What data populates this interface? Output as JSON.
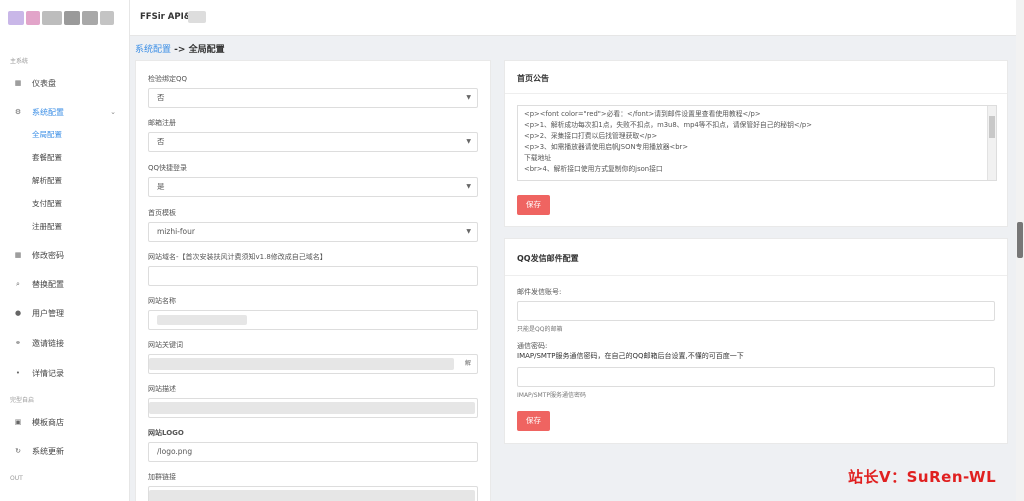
{
  "topbar": {
    "brand": "FFSir API&"
  },
  "sidebar": {
    "section1": "主系统",
    "section2": "完型自启",
    "section3": "OUT",
    "items": [
      {
        "icon": "dashboard-icon",
        "label": "仪表盘"
      },
      {
        "icon": "settings-icon",
        "label": "系统配置"
      },
      {
        "icon": "lock-icon",
        "label": "修改密码"
      },
      {
        "icon": "swap-icon",
        "label": "替换配置"
      },
      {
        "icon": "user-icon",
        "label": "用户管理"
      },
      {
        "icon": "link-icon",
        "label": "邀请链接"
      },
      {
        "icon": "record-icon",
        "label": "详情记录"
      },
      {
        "icon": "store-icon",
        "label": "模板商店"
      },
      {
        "icon": "update-icon",
        "label": "系统更新"
      }
    ],
    "sub_items": [
      "全局配置",
      "套餐配置",
      "解析配置",
      "支付配置",
      "注册配置"
    ]
  },
  "breadcrumb": {
    "parent": "系统配置",
    "separator": " -> ",
    "current": "全局配置"
  },
  "left_form": {
    "fields": [
      {
        "label": "检验绑定QQ",
        "value": "否"
      },
      {
        "label": "邮箱注册",
        "value": "否"
      },
      {
        "label": "QQ快捷登录",
        "value": "是"
      },
      {
        "label": "首页模板",
        "value": "mizhi-four"
      },
      {
        "label": "网站域名-【首次安装扶风计费须知v1.8修改成自己域名】",
        "value": ""
      },
      {
        "label": "网站名称",
        "value": ""
      },
      {
        "label": "网站关键词",
        "value": ""
      },
      {
        "label": "网站描述",
        "value": ""
      },
      {
        "label": "网站LOGO",
        "value": "/logo.png"
      },
      {
        "label": "加群链接",
        "value": ""
      }
    ],
    "keyword_suffix": "解"
  },
  "notice_card": {
    "title": "首页公告",
    "lines": [
      "<p><font color=\"red\">必看：</font>请到邮件设置里查看使用教程</p>",
      "<p>1、解析成功每次扣1点，失败不扣点，m3u8、mp4等不扣点，请保管好自己的秘钥</p>",
      "<p>2、采集接口打费以后找管理获取</p>",
      "<p>3、如需播放器请使用启帆JSON专用播放器<br>",
      "下载地址",
      "<br>4、解析接口使用方式复制你的json接口"
    ],
    "save_label": "保存"
  },
  "mail_card": {
    "title": "QQ发信邮件配置",
    "account_label": "邮件发信账号:",
    "account_hint": "只能是QQ的邮箱",
    "password_label": "通信密码:",
    "password_desc": "IMAP/SMTP服务通信密码，在自己的QQ邮箱后台设置,不懂的可百度一下",
    "password_hint": "IMAP/SMTP服务通信密码",
    "save_label": "保存"
  },
  "watermark": "站长V：SuRen-WL"
}
